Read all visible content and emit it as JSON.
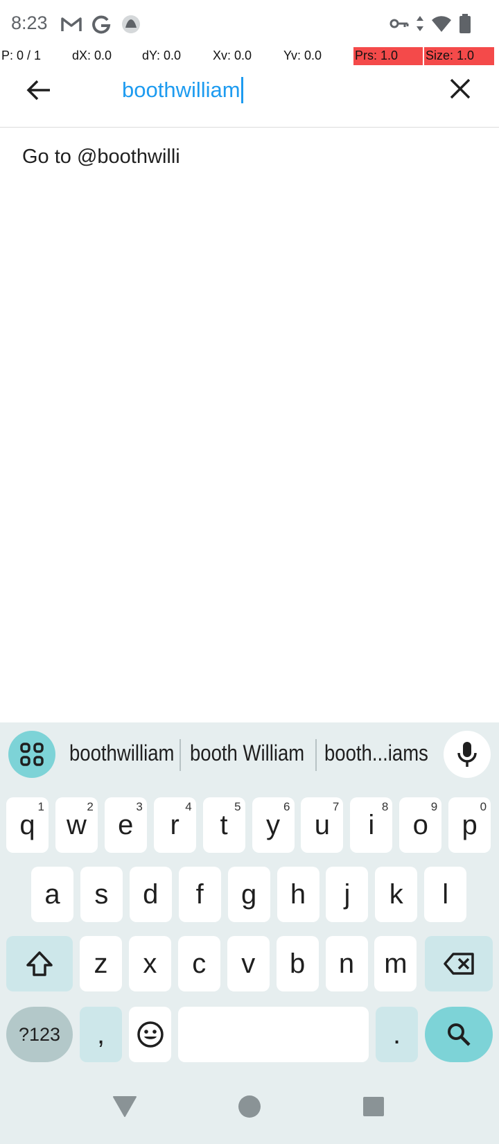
{
  "status_bar": {
    "time": "8:23",
    "left_icons": [
      "gmail-icon",
      "google-icon",
      "app-notification-icon"
    ],
    "right_icons": [
      "vpn-key-icon",
      "data-arrows-icon",
      "wifi-icon",
      "battery-icon"
    ]
  },
  "pointer_overlay": {
    "p": "P: 0 / 1",
    "dx": "dX: 0.0",
    "dy": "dY: 0.0",
    "xv": "Xv: 0.0",
    "yv": "Yv: 0.0",
    "prs": "Prs: 1.0",
    "size": "Size: 1.0",
    "highlight_color": "#f44a4a"
  },
  "search_header": {
    "query": "boothwilliam",
    "query_color": "#1d9bf0",
    "back_icon": "arrow-left-icon",
    "clear_icon": "close-icon"
  },
  "results": [
    {
      "label": "Go to @boothwilli"
    }
  ],
  "keyboard": {
    "suggestions": [
      "boothwilliam",
      "booth William",
      "booth...iams"
    ],
    "rows": [
      [
        {
          "k": "q",
          "h": "1"
        },
        {
          "k": "w",
          "h": "2"
        },
        {
          "k": "e",
          "h": "3"
        },
        {
          "k": "r",
          "h": "4"
        },
        {
          "k": "t",
          "h": "5"
        },
        {
          "k": "y",
          "h": "6"
        },
        {
          "k": "u",
          "h": "7"
        },
        {
          "k": "i",
          "h": "8"
        },
        {
          "k": "o",
          "h": "9"
        },
        {
          "k": "p",
          "h": "0"
        }
      ],
      [
        {
          "k": "a"
        },
        {
          "k": "s"
        },
        {
          "k": "d"
        },
        {
          "k": "f"
        },
        {
          "k": "g"
        },
        {
          "k": "h"
        },
        {
          "k": "j"
        },
        {
          "k": "k"
        },
        {
          "k": "l"
        }
      ],
      [
        {
          "k": "z"
        },
        {
          "k": "x"
        },
        {
          "k": "c"
        },
        {
          "k": "v"
        },
        {
          "k": "b"
        },
        {
          "k": "n"
        },
        {
          "k": "m"
        }
      ]
    ],
    "symbols_label": "?123",
    "comma_label": ",",
    "period_label": ".",
    "accent_color": "#7dd3d7",
    "modifier_color": "#cde7ea"
  },
  "nav_bar": {
    "icons": [
      "back-triangle-icon",
      "home-circle-icon",
      "recents-square-icon"
    ]
  }
}
